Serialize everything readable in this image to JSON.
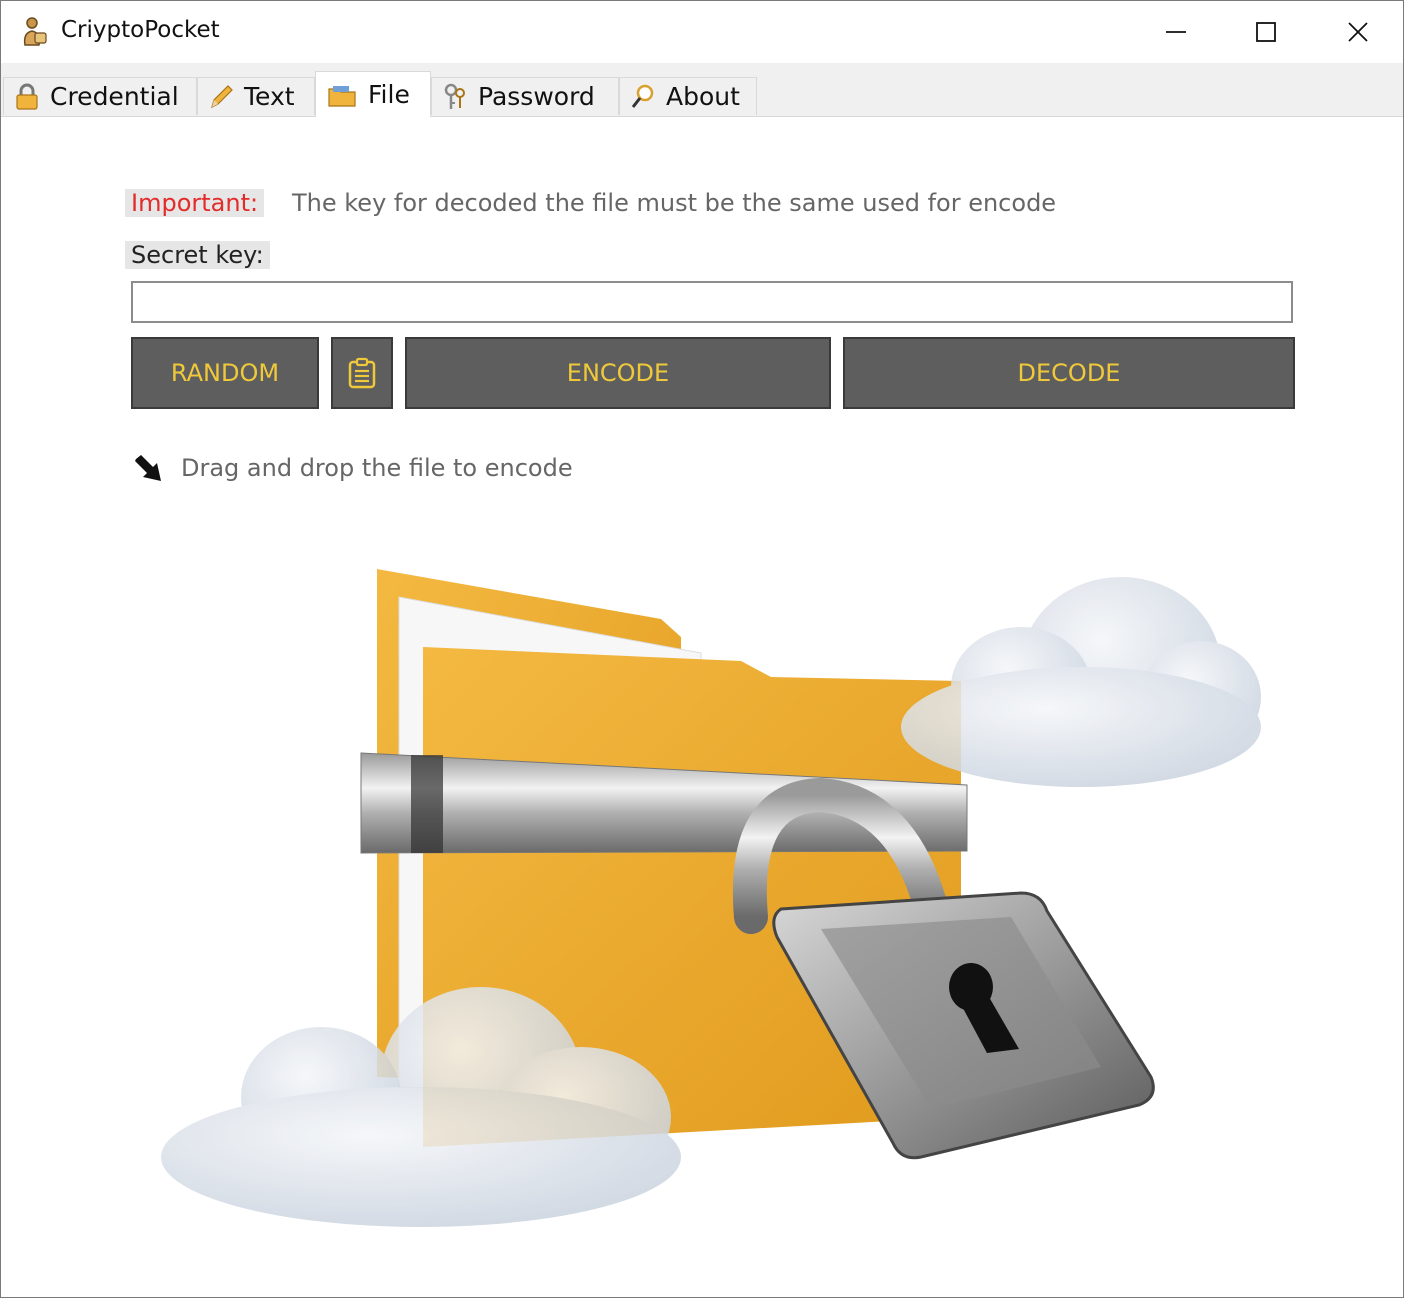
{
  "window": {
    "title": "CriyptoPocket"
  },
  "tabs": [
    {
      "label": "Credential",
      "icon": "lock-icon"
    },
    {
      "label": "Text",
      "icon": "pencil-icon"
    },
    {
      "label": "File",
      "icon": "folder-icon",
      "active": true
    },
    {
      "label": "Password",
      "icon": "keys-icon"
    },
    {
      "label": "About",
      "icon": "magnifier-icon"
    }
  ],
  "file_panel": {
    "important_label": "Important:",
    "important_text": "The key for decoded the file must be the same used for encode",
    "secret_key_label": "Secret key:",
    "secret_key_value": "",
    "random_label": "RANDOM",
    "encode_label": "ENCODE",
    "decode_label": "DECODE",
    "drag_text": "Drag and drop the file to encode"
  },
  "colors": {
    "button_bg": "#5e5e5e",
    "button_text": "#f0c93b",
    "important_text": "#e32b2b",
    "folder": "#f0b43c"
  }
}
